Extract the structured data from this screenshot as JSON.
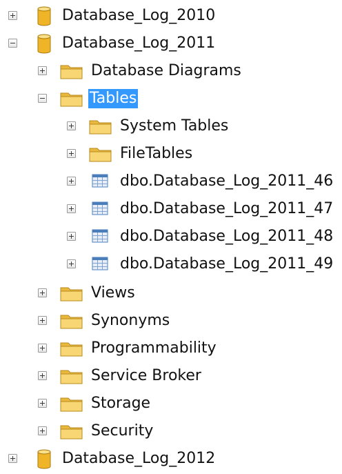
{
  "tree": {
    "nodes": [
      {
        "label": "Database_Log_2010",
        "type": "database",
        "expanded": false,
        "selected": false
      },
      {
        "label": "Database_Log_2011",
        "type": "database",
        "expanded": true,
        "selected": false
      },
      {
        "label": "Database Diagrams",
        "type": "folder",
        "expanded": false,
        "selected": false
      },
      {
        "label": "Tables",
        "type": "folder",
        "expanded": true,
        "selected": true
      },
      {
        "label": "System Tables",
        "type": "folder",
        "expanded": false,
        "selected": false
      },
      {
        "label": "FileTables",
        "type": "folder",
        "expanded": false,
        "selected": false
      },
      {
        "label": "dbo.Database_Log_2011_46",
        "type": "table",
        "expanded": false,
        "selected": false
      },
      {
        "label": "dbo.Database_Log_2011_47",
        "type": "table",
        "expanded": false,
        "selected": false
      },
      {
        "label": "dbo.Database_Log_2011_48",
        "type": "table",
        "expanded": false,
        "selected": false
      },
      {
        "label": "dbo.Database_Log_2011_49",
        "type": "table",
        "expanded": false,
        "selected": false
      },
      {
        "label": "Views",
        "type": "folder",
        "expanded": false,
        "selected": false
      },
      {
        "label": "Synonyms",
        "type": "folder",
        "expanded": false,
        "selected": false
      },
      {
        "label": "Programmability",
        "type": "folder",
        "expanded": false,
        "selected": false
      },
      {
        "label": "Service Broker",
        "type": "folder",
        "expanded": false,
        "selected": false
      },
      {
        "label": "Storage",
        "type": "folder",
        "expanded": false,
        "selected": false
      },
      {
        "label": "Security",
        "type": "folder",
        "expanded": false,
        "selected": false
      },
      {
        "label": "Database_Log_2012",
        "type": "database",
        "expanded": false,
        "selected": false
      }
    ]
  },
  "colors": {
    "selection": "#3399ff",
    "folder": "#f2c94c",
    "database": "#f0b429",
    "table_icon": "#4a7ebb"
  }
}
